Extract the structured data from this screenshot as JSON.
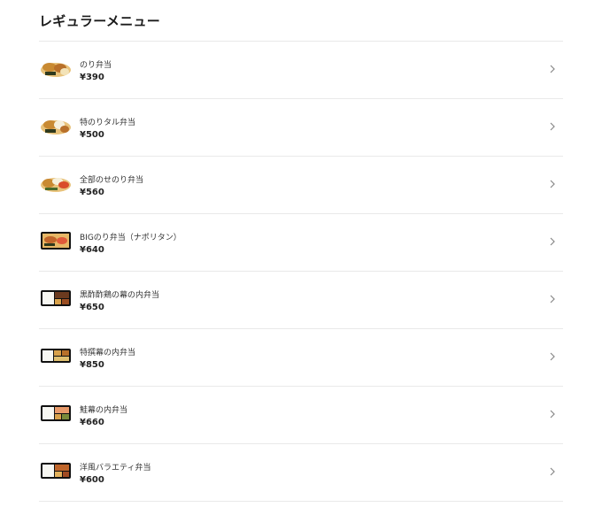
{
  "section": {
    "title": "レギュラーメニュー"
  },
  "items": [
    {
      "name": "のり弁当",
      "price": "¥390",
      "thumb": "rice-box-open"
    },
    {
      "name": "特のりタル弁当",
      "price": "¥500",
      "thumb": "rice-box-open"
    },
    {
      "name": "全部のせのり弁当",
      "price": "¥560",
      "thumb": "rice-box-open"
    },
    {
      "name": "BIGのり弁当（ナポリタン）",
      "price": "¥640",
      "thumb": "black-tray-box"
    },
    {
      "name": "黒酢酢鶏の幕の内弁当",
      "price": "¥650",
      "thumb": "black-tray-box"
    },
    {
      "name": "特撰幕の内弁当",
      "price": "¥850",
      "thumb": "black-tray-box"
    },
    {
      "name": "鮭幕の内弁当",
      "price": "¥660",
      "thumb": "black-tray-box"
    },
    {
      "name": "洋風バラエティ弁当",
      "price": "¥600",
      "thumb": "black-tray-box"
    }
  ],
  "icons": {
    "row_action": "chevron-right-icon"
  }
}
